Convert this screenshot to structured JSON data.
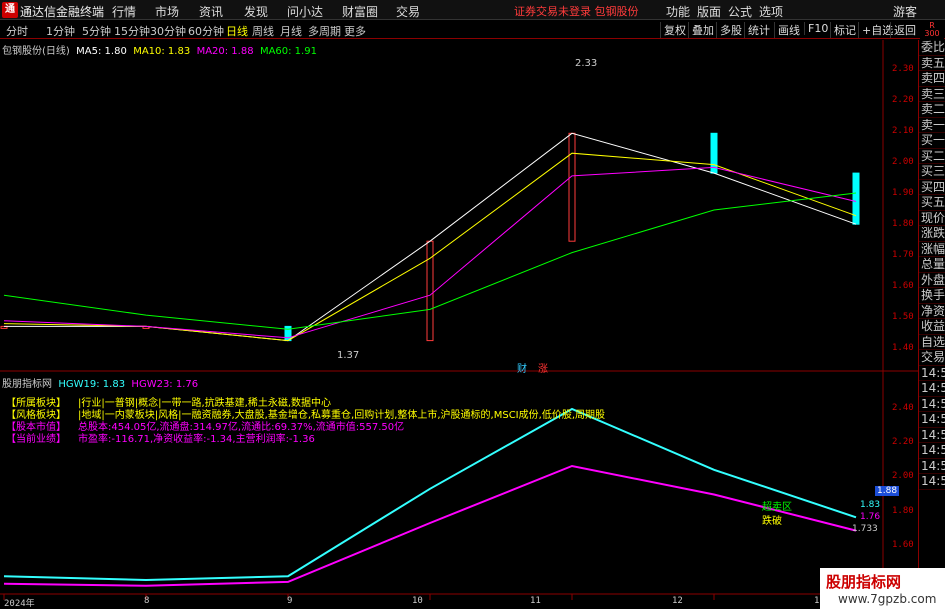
{
  "app": {
    "name": "通达信金融终端",
    "logo_char": "通"
  },
  "menu": [
    "行情",
    "市场",
    "资讯",
    "发现",
    "问小达",
    "财富圈",
    "交易"
  ],
  "warning": "证券交易未登录  包钢股份",
  "menu_right": [
    "功能",
    "版面",
    "公式",
    "选项",
    "游客"
  ],
  "periods": [
    "分时",
    "1分钟",
    "5分钟",
    "15分钟",
    "30分钟",
    "60分钟",
    "日线",
    "周线",
    "月线",
    "多周期",
    "更多"
  ],
  "active_period": "日线",
  "toolbar_buttons": [
    "复权",
    "叠加",
    "多股",
    "统计",
    "画线",
    "F10",
    "标记",
    "+自选",
    "返回"
  ],
  "main_chart": {
    "stock": "包钢股份(日线)",
    "ma": [
      {
        "label": "MA5: 1.80",
        "color": "#ffffff"
      },
      {
        "label": "MA10: 1.83",
        "color": "#ffff00"
      },
      {
        "label": "MA20: 1.88",
        "color": "#ff00ff"
      },
      {
        "label": "MA60: 1.91",
        "color": "#00ff00"
      }
    ],
    "y_axis": [
      "2.30",
      "2.20",
      "2.10",
      "2.00",
      "1.90",
      "1.80",
      "1.70",
      "1.60",
      "1.50",
      "1.40"
    ],
    "high_label": "2.33",
    "low_label": "1.37",
    "markers": [
      "财",
      "涨"
    ]
  },
  "indicator": {
    "name": "股朋指标网",
    "hgw19": "HGW19: 1.83",
    "hgw23": "HGW23: 1.76",
    "lines": [
      {
        "label": "【所属板块】",
        "text": "|行业|一普钢|概念|一带一路,抗跌基建,稀土永磁,数据中心"
      },
      {
        "label": "【风格板块】",
        "text": "|地域|一内蒙板块|风格|一融资融券,大盘股,基金增仓,私募重仓,回购计划,整体上市,沪股通标的,MSCI成份,低价股,周期股"
      },
      {
        "label": "【股本市值】",
        "text": "总股本:454.05亿,流通盘:314.97亿,流通比:69.37%,流通市值:557.50亿"
      },
      {
        "label": "【当前业绩】",
        "text": "市盈率:-116.71,净资收益率:-1.34,主营利润率:-1.36"
      }
    ],
    "y_axis": [
      "2.40",
      "2.20",
      "2.00",
      "1.80",
      "1.60"
    ],
    "current": "1.88",
    "end_labels": [
      "1.83",
      "1.76",
      "1.733"
    ],
    "signals": [
      "超卖区",
      "跌破"
    ]
  },
  "x_axis": [
    "2024年",
    "8",
    "9",
    "10",
    "11",
    "12",
    "1"
  ],
  "right_panel": [
    "委比",
    "卖五",
    "卖四",
    "卖三",
    "卖二",
    "卖一",
    "买一",
    "买二",
    "买三",
    "买四",
    "买五",
    "现价",
    "涨跌",
    "涨幅",
    "总量",
    "外盘",
    "换手",
    "净资",
    "收益",
    "自选",
    "交易",
    "14:56",
    "14:56",
    "14:56",
    "14:56",
    "14:56",
    "14:56",
    "14:56",
    "14:56"
  ],
  "right_top": {
    "r": "R",
    "num": "300"
  },
  "banner": {
    "title": "股朋指标网",
    "url": "www.7gpzb.com"
  },
  "chart_data": [
    {
      "type": "line",
      "title": "包钢股份(日线)",
      "x": [
        "2024-07",
        "2024-08",
        "2024-09",
        "2024-10",
        "2024-11",
        "2024-12",
        "2025-01"
      ],
      "series": [
        {
          "name": "MA5",
          "values": [
            1.44,
            1.44,
            1.39,
            1.74,
            2.12,
            1.98,
            1.8
          ]
        },
        {
          "name": "MA10",
          "values": [
            1.45,
            1.44,
            1.39,
            1.68,
            2.05,
            2.01,
            1.83
          ]
        },
        {
          "name": "MA20",
          "values": [
            1.46,
            1.44,
            1.4,
            1.55,
            1.97,
            2.0,
            1.88
          ]
        },
        {
          "name": "MA60",
          "values": [
            1.55,
            1.48,
            1.43,
            1.5,
            1.7,
            1.85,
            1.91
          ]
        }
      ],
      "ylim": [
        1.35,
        2.35
      ],
      "high": 2.33,
      "low": 1.37
    },
    {
      "type": "line",
      "title": "股朋指标网",
      "x": [
        "2024-07",
        "2024-08",
        "2024-09",
        "2024-10",
        "2024-11",
        "2024-12",
        "2025-01"
      ],
      "series": [
        {
          "name": "HGW19",
          "values": [
            1.52,
            1.5,
            1.52,
            1.98,
            2.4,
            2.08,
            1.83
          ]
        },
        {
          "name": "HGW23",
          "values": [
            1.48,
            1.47,
            1.49,
            1.8,
            2.1,
            1.95,
            1.76
          ]
        }
      ],
      "ylim": [
        1.5,
        2.5
      ]
    }
  ]
}
